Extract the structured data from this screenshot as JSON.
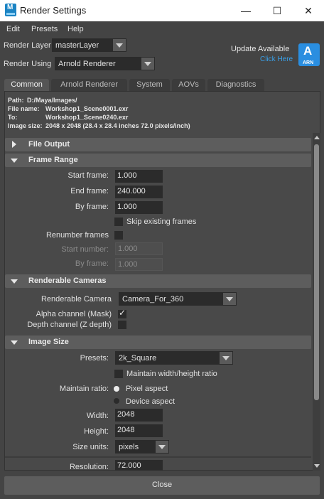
{
  "window": {
    "title": "Render Settings",
    "app_icon_letter": "M",
    "minimize": "—",
    "maximize": "☐",
    "close": "✕"
  },
  "menu": [
    "Edit",
    "Presets",
    "Help"
  ],
  "render_layer": {
    "label": "Render Layer",
    "value": "masterLayer"
  },
  "render_using": {
    "label": "Render Using",
    "value": "Arnold Renderer"
  },
  "update": {
    "title": "Update Available",
    "link": "Click Here",
    "logo_letter": "A",
    "logo_text": "ARN"
  },
  "tabs": [
    "Common",
    "Arnold Renderer",
    "System",
    "AOVs",
    "Diagnostics"
  ],
  "info": {
    "path_label": "Path:",
    "path": "D:/Maya/Images/",
    "file_label": "File name:",
    "file": "Workshop1_Scene0001.exr",
    "to_label": "To:",
    "to": "Workshop1_Scene0240.exr",
    "size_label": "Image size:",
    "size": "2048 x 2048 (28.4 x 28.4 inches 72.0 pixels/inch)"
  },
  "sections": {
    "file_output": "File Output",
    "frame_range": "Frame Range",
    "renderable_cameras": "Renderable Cameras",
    "image_size": "Image Size"
  },
  "frame_range": {
    "start_label": "Start frame:",
    "start": "1.000",
    "end_label": "End frame:",
    "end": "240.000",
    "by_label": "By frame:",
    "by": "1.000",
    "skip_label": "Skip existing frames",
    "renumber_label": "Renumber frames",
    "start_number_label": "Start number:",
    "start_number": "1.000",
    "by_frame2_label": "By frame:",
    "by_frame2": "1.000"
  },
  "cameras": {
    "camera_label": "Renderable Camera",
    "camera": "Camera_For_360",
    "alpha_label": "Alpha channel (Mask)",
    "alpha_checked": true,
    "depth_label": "Depth channel (Z depth)",
    "depth_checked": false
  },
  "image_size": {
    "presets_label": "Presets:",
    "preset": "2k_Square",
    "maintain_wh_label": "Maintain width/height ratio",
    "maintain_ratio_label": "Maintain ratio:",
    "pixel_aspect": "Pixel aspect",
    "device_aspect": "Device aspect",
    "width_label": "Width:",
    "width": "2048",
    "height_label": "Height:",
    "height": "2048",
    "size_units_label": "Size units:",
    "size_units": "pixels",
    "resolution_label": "Resolution:",
    "resolution": "72.000"
  },
  "close_label": "Close"
}
